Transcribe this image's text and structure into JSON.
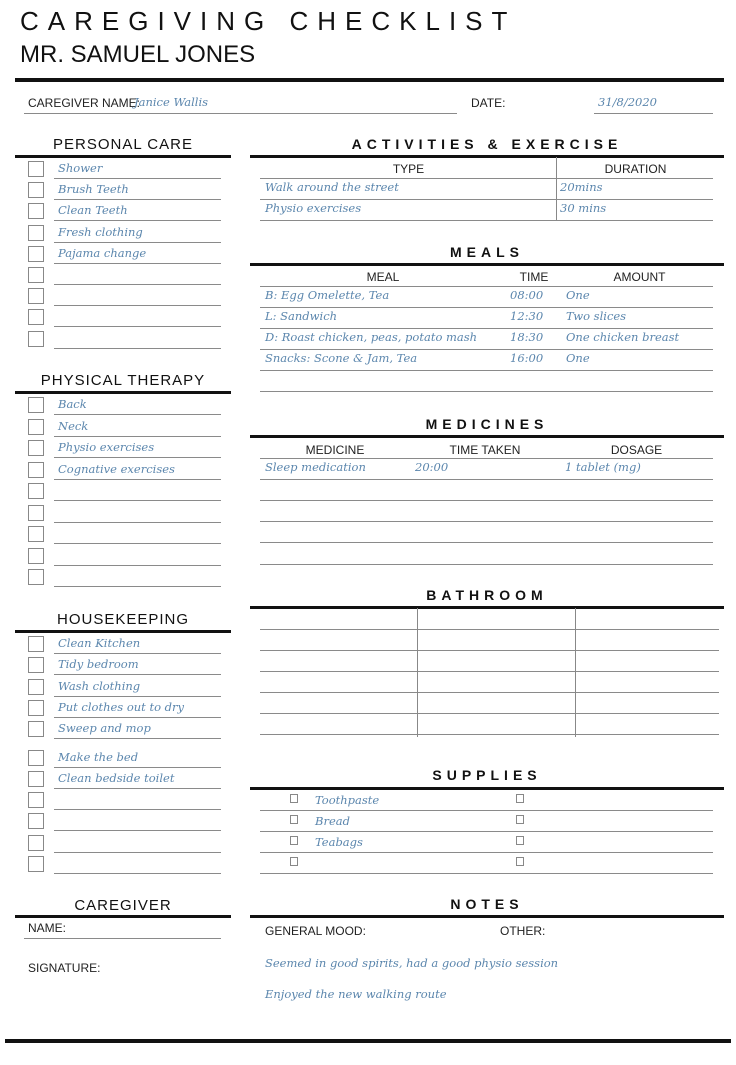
{
  "header": {
    "title": "CAREGIVING CHECKLIST",
    "patient": "MR. SAMUEL JONES"
  },
  "info": {
    "caregiver_label": "CAREGIVER NAME:",
    "caregiver_value": "Janice Wallis",
    "date_label": "DATE:",
    "date_value": "31/8/2020"
  },
  "personal_care": {
    "title": "PERSONAL CARE",
    "items": [
      "Shower",
      "Brush Teeth",
      "Clean Teeth",
      "Fresh clothing",
      "Pajama change",
      "",
      "",
      "",
      ""
    ]
  },
  "physical_therapy": {
    "title": "PHYSICAL THERAPY",
    "items": [
      "Back",
      "Neck",
      "Physio exercises",
      "Cognative exercises",
      "",
      "",
      "",
      "",
      ""
    ]
  },
  "housekeeping": {
    "title": "HOUSEKEEPING",
    "items": [
      "Clean Kitchen",
      "Tidy bedroom",
      "Wash clothing",
      "Put clothes out to dry",
      "Sweep and mop",
      "Make the bed",
      "Clean bedside toilet",
      "",
      "",
      "",
      ""
    ]
  },
  "activities": {
    "title": "ACTIVITIES & EXERCISE",
    "columns": [
      "TYPE",
      "DURATION"
    ],
    "rows": [
      [
        "Walk around the street",
        "20mins"
      ],
      [
        "Physio exercises",
        "30 mins"
      ]
    ]
  },
  "meals": {
    "title": "MEALS",
    "columns": [
      "MEAL",
      "TIME",
      "AMOUNT"
    ],
    "rows": [
      [
        "B: Egg Omelette, Tea",
        "08:00",
        "One"
      ],
      [
        "L: Sandwich",
        "12:30",
        "Two slices"
      ],
      [
        "D: Roast chicken, peas, potato mash",
        "18:30",
        "One chicken breast"
      ],
      [
        "Snacks: Scone & Jam, Tea",
        "16:00",
        "One"
      ],
      [
        "",
        "",
        ""
      ]
    ]
  },
  "medicines": {
    "title": "MEDICINES",
    "columns": [
      "MEDICINE",
      "TIME TAKEN",
      "DOSAGE"
    ],
    "rows": [
      [
        "Sleep medication",
        "20:00",
        "1 tablet (mg)"
      ],
      [
        "",
        "",
        ""
      ],
      [
        "",
        "",
        ""
      ],
      [
        "",
        "",
        ""
      ],
      [
        "",
        "",
        ""
      ]
    ]
  },
  "bathroom": {
    "title": "BATHROOM",
    "rows": 6
  },
  "supplies": {
    "title": "SUPPLIES",
    "items": [
      [
        "Toothpaste",
        ""
      ],
      [
        "Bread",
        ""
      ],
      [
        "Teabags",
        ""
      ],
      [
        "",
        ""
      ]
    ]
  },
  "caregiver": {
    "title": "CAREGIVER",
    "name_label": "NAME:",
    "signature_label": "SIGNATURE:"
  },
  "notes": {
    "title": "NOTES",
    "mood_label": "GENERAL MOOD:",
    "other_label": "OTHER:",
    "lines": [
      "Seemed in good spirits, had a good physio session",
      "Enjoyed the new walking route"
    ]
  }
}
